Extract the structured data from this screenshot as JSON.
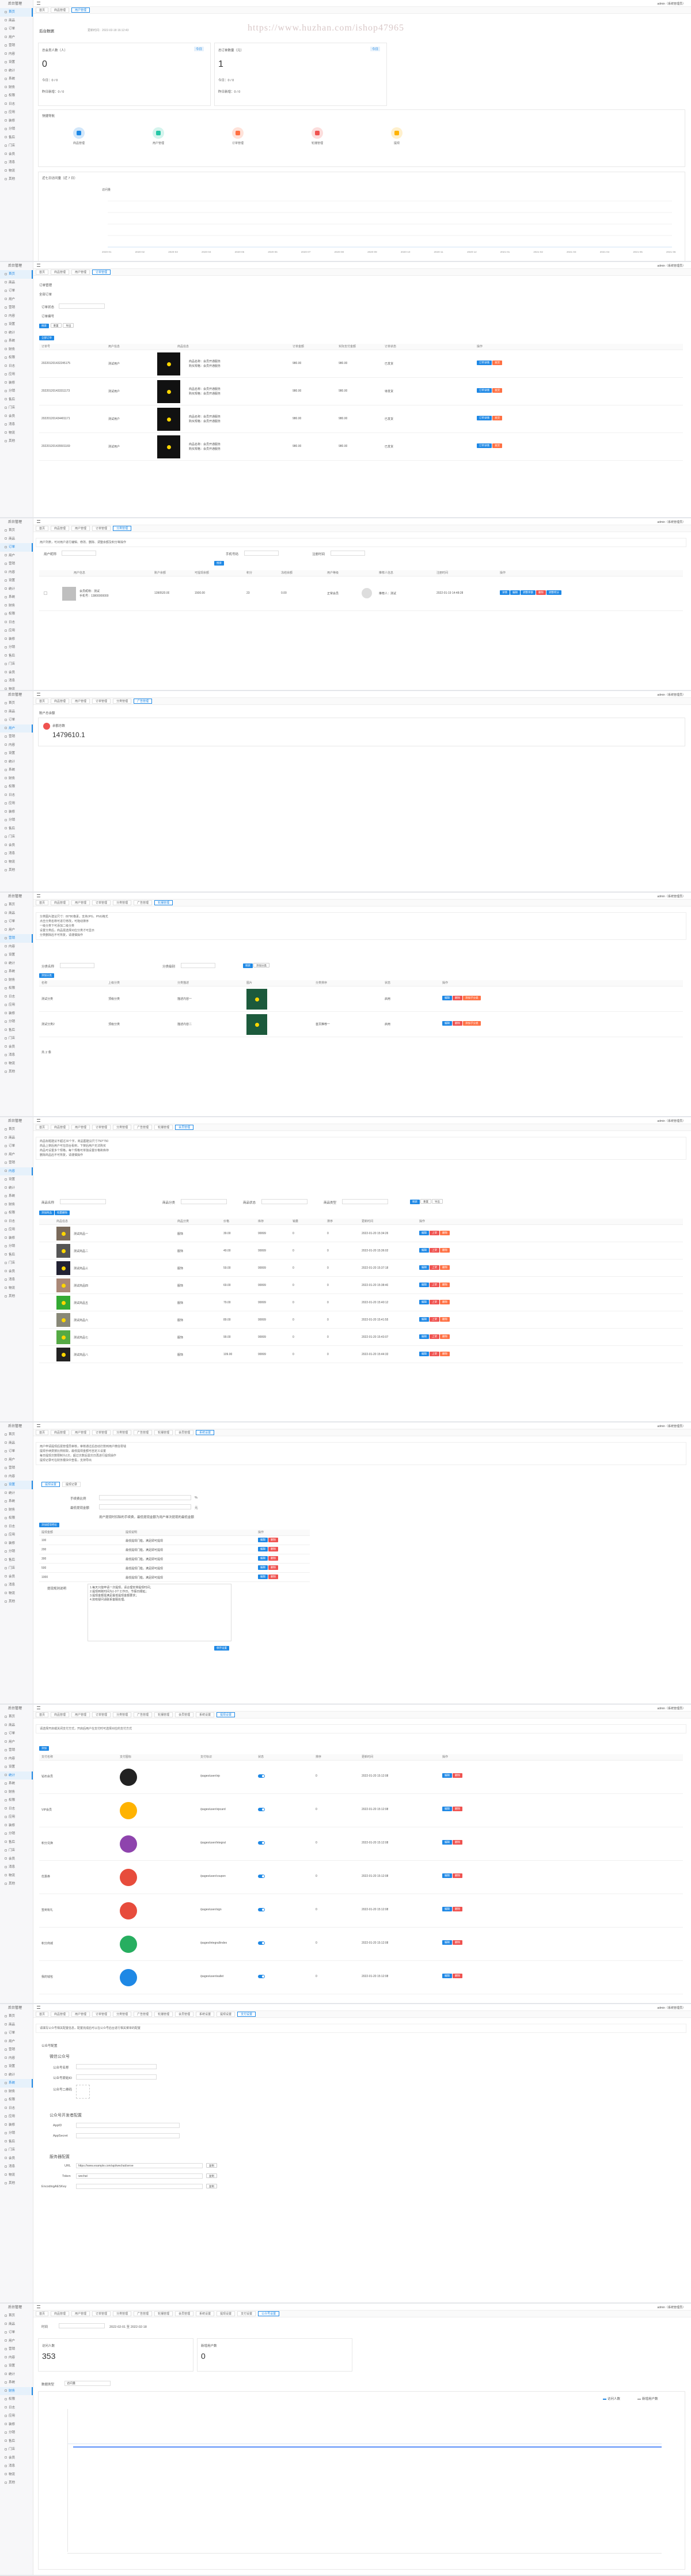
{
  "app": {
    "user": "admin（系统管理员）",
    "logo_text": "后台管理",
    "home_tab": "首页",
    "watermark": "https://www.huzhan.com/ishop47965"
  },
  "colors": {
    "primary": "#1e88e5",
    "danger": "#ef5350",
    "warn": "#ff7043"
  },
  "sidebar": [
    "后台管理",
    "首页",
    "商品",
    "订单",
    "用户",
    "营销",
    "内容",
    "设置",
    "统计",
    "系统",
    "财务",
    "权限",
    "日志",
    "应用",
    "装修",
    "分销",
    "售后",
    "门店",
    "会员",
    "消息",
    "物流",
    "其他"
  ],
  "tabs": [
    "首页",
    "商品管理",
    "用户管理",
    "订单管理",
    "分类管理",
    "广告管理",
    "轮播管理",
    "会员管理",
    "系统设置",
    "提现设置",
    "支付设置",
    "公众号设置",
    "版本",
    "数据"
  ],
  "dash": {
    "title": "后台数据",
    "date": "更新时间：2022-02-18 16:12:43",
    "card1_label": "总会员人数（人）",
    "card1_tag": "今日",
    "card1_value": "0",
    "card1_sub1": "今日：0 / 0",
    "card1_sub2": "昨日新增：0 / 0",
    "card2_label": "总订单数量（元）",
    "card2_tag": "今日",
    "card2_value": "1",
    "card2_sub1": "今日：0 / 0",
    "card2_sub2": "昨日新增：0 / 0",
    "quick_title": "快捷导航",
    "quick": [
      "商品管理",
      "用户管理",
      "订单管理",
      "轮播管理",
      "提现"
    ],
    "chart_title": "近七日访问量（近 7 日）",
    "chart_series": "访问量",
    "chart_months": [
      "2020-01",
      "2020-02",
      "2020-03",
      "2020-04",
      "2020-05",
      "2020-06",
      "2020-07",
      "2020-08",
      "2020-09",
      "2020-10",
      "2020-11",
      "2020-12",
      "2021-01",
      "2021-02",
      "2021-03",
      "2021-04",
      "2021-05",
      "2021-06"
    ]
  },
  "orders": {
    "sub": [
      "订单管理",
      "全部订单"
    ],
    "filter_label": "订单状态",
    "filter2": "订单编号",
    "btn_search": "搜索",
    "btn_reset": "重置",
    "btn_export": "导出",
    "tag": "全部订单",
    "cols": [
      "订单号",
      "用户信息",
      "商品信息",
      "订单金额",
      "实际支付金额",
      "订单状态",
      "操作"
    ],
    "rows": [
      {
        "no": "202201201432245175",
        "user": "测试用户",
        "info1": "商品名称：会员开通服务",
        "info2": "购买规格：会员开通服务",
        "amount": "980.00",
        "paid": "980.00",
        "status": "已发货"
      },
      {
        "no": "202201201433311173",
        "user": "测试用户",
        "info1": "商品名称：会员开通服务",
        "info2": "购买规格：会员开通服务",
        "amount": "980.00",
        "paid": "980.00",
        "status": "待发货"
      },
      {
        "no": "202201201434401171",
        "user": "测试用户",
        "info1": "商品名称：会员开通服务",
        "info2": "购买规格：会员开通服务",
        "amount": "980.00",
        "paid": "980.00",
        "status": "已发货"
      },
      {
        "no": "202201201435501169",
        "user": "测试用户",
        "info1": "商品名称：会员开通服务",
        "info2": "购买规格：会员开通服务",
        "amount": "980.00",
        "paid": "980.00",
        "status": "已发货"
      }
    ],
    "b1": "订单详情",
    "b2": "发货"
  },
  "users": {
    "tip": "用户列表，可对用户进行编辑、修改、删除、调整余额及积分等操作",
    "lbl1": "用户昵称",
    "lbl2": "手机号码",
    "lbl3": "注册时间",
    "btn": "搜索",
    "cols": [
      "用户信息",
      "账户余额",
      "可提现余额",
      "积分",
      "冻结余额",
      "用户等级",
      "推荐人信息",
      "注册时间",
      "操作"
    ],
    "row": {
      "name": "会员昵称：测试",
      "phone": "手机号：13800000000",
      "bal": "1390520.00",
      "cash": "1500.00",
      "pts": "23",
      "frz": "0.00",
      "lvl": "正常会员",
      "ref": "推荐人：测试",
      "time": "2022-01-19 14:48:28"
    },
    "btns": [
      "详情",
      "编辑",
      "调整余额",
      "删除",
      "调整积分"
    ]
  },
  "balance": {
    "title": "账户总余额",
    "label": "余额总数",
    "value": "1479610.1"
  },
  "cats": {
    "tip": [
      "分类图片建议尺寸：80*80像素，支持JPG、PNG格式",
      "点击分类名称可进行修改，可拖动排序",
      "一级分类下可添加二级分类",
      "设置分类后，商品需选择对应分类才可显示",
      "分类删除后不可恢复，请谨慎操作"
    ],
    "lbl1": "分类名称",
    "lbl2": "分类级别",
    "btn1": "搜索",
    "btn2": "添加分类",
    "tag": "添加分类",
    "cols": [
      "名称",
      "上级分类",
      "分类描述",
      "图片",
      "分类排序",
      "状态",
      "操作"
    ],
    "rows": [
      {
        "name": "测试分类",
        "parent": "顶级分类",
        "desc": "描述内容一",
        "sort": "",
        "status": "启用"
      },
      {
        "name": "测试分类2",
        "parent": "顶级分类",
        "desc": "描述内容二",
        "sort": "首页推荐一",
        "status": "启用"
      }
    ],
    "btns": [
      "编辑",
      "删除",
      "添加子分类"
    ],
    "pager": "共 2 条"
  },
  "goods": {
    "tip": [
      "商品标题建议不超过30个字，商品图建议尺寸750*750",
      "商品上架后用户可在前台看到，下架后用户无法购买",
      "商品可设置多个规格，每个规格可单独设置价格和库存",
      "删除商品后不可恢复，请谨慎操作"
    ],
    "lbl1": "商品名称",
    "lbl2": "商品分类",
    "lbl3": "商品状态",
    "lbl4": "商品类型",
    "btn1": "搜索",
    "btn2": "重置",
    "btn3": "导出",
    "tag1": "添加商品",
    "tag2": "批量删除",
    "cols": [
      "商品信息",
      "商品分类",
      "价格",
      "库存",
      "销量",
      "排序",
      "更新时间",
      "操作"
    ],
    "rows": [
      {
        "name": "测试商品一",
        "cat": "服饰",
        "price": "39.00",
        "stock": "99999",
        "sales": "0",
        "sort": "0",
        "time": "2022-01-20 15:34:26"
      },
      {
        "name": "测试商品二",
        "cat": "服饰",
        "price": "49.00",
        "stock": "99999",
        "sales": "0",
        "sort": "0",
        "time": "2022-01-20 15:36:02"
      },
      {
        "name": "测试商品三",
        "cat": "服饰",
        "price": "59.00",
        "stock": "99999",
        "sales": "0",
        "sort": "0",
        "time": "2022-01-20 15:37:18"
      },
      {
        "name": "测试商品四",
        "cat": "服饰",
        "price": "69.00",
        "stock": "99999",
        "sales": "0",
        "sort": "0",
        "time": "2022-01-20 15:38:40"
      },
      {
        "name": "测试商品五",
        "cat": "服饰",
        "price": "79.00",
        "stock": "99999",
        "sales": "0",
        "sort": "0",
        "time": "2022-01-20 15:40:12"
      },
      {
        "name": "测试商品六",
        "cat": "服饰",
        "price": "89.00",
        "stock": "99999",
        "sales": "0",
        "sort": "0",
        "time": "2022-01-20 15:41:55"
      },
      {
        "name": "测试商品七",
        "cat": "服饰",
        "price": "99.00",
        "stock": "99999",
        "sales": "0",
        "sort": "0",
        "time": "2022-01-20 15:43:07"
      },
      {
        "name": "测试商品八",
        "cat": "服饰",
        "price": "109.00",
        "stock": "99999",
        "sales": "0",
        "sort": "0",
        "time": "2022-01-20 15:44:33"
      }
    ],
    "btns": [
      "编辑",
      "上架",
      "删除"
    ]
  },
  "withdraw": {
    "tip": [
      "用户申请提现后需管理员审核，审核通过后自动打款到用户微信零钱",
      "提现手续费按比例收取，最低提现金额可自定义设置",
      "每日提现次数限制为1次，超过次数后需次日再进行提现操作",
      "提现记录可在财务模块中查看，支持导出"
    ],
    "tab1": "提现设置",
    "tab2": "提现记录",
    "lbl1": "手续费比例",
    "lbl2": "最低提现金额",
    "unit1": "%",
    "unit2": "元",
    "note": "用户提现时扣除的手续费，最低提现金额为用户单次提现的最低金额",
    "tag": "添加提现档位",
    "cols": [
      "提现金额",
      "提现说明",
      "操作"
    ],
    "rows": [
      {
        "a": "100",
        "d": "最低提现门槛，满足即可提现"
      },
      {
        "a": "200",
        "d": "最低提现门槛，满足即可提现"
      },
      {
        "a": "300",
        "d": "最低提现门槛，满足即可提现"
      },
      {
        "a": "500",
        "d": "最低提现门槛，满足即可提现"
      },
      {
        "a": "1000",
        "d": "最低提现门槛，满足即可提现"
      }
    ],
    "desc_label": "提现规则说明",
    "desc": [
      "1.每天只能申请一次提现，请合理安排提现时间；",
      "2.提现到账时间为1-3个工作日，节假日顺延；",
      "3.提现金额需满足最低提现金额要求；",
      "4.如有疑问请联系客服处理。"
    ],
    "save": "保存设置"
  },
  "pay": {
    "tip": "请选择开启或关闭支付方式，开启后用户在支付时可选择对应的支付方式",
    "tag": "添加",
    "cols": [
      "支付名称",
      "支付图标",
      "支付标识",
      "状态",
      "排序",
      "更新时间",
      "操作"
    ],
    "rows": [
      {
        "name": "钻石会员",
        "code": "/pages/user/vip"
      },
      {
        "name": "VIP会员",
        "code": "/pages/user/vipcard"
      },
      {
        "name": "积分兑换",
        "code": "/pages/user/integral"
      },
      {
        "name": "优惠券",
        "code": "/pages/user/coupon"
      },
      {
        "name": "签到有礼",
        "code": "/pages/user/sign"
      },
      {
        "name": "积分商城",
        "code": "/pages/integral/index"
      },
      {
        "name": "我的钱包",
        "code": "/pages/user/wallet"
      }
    ],
    "sort": "0",
    "time": "2022-01-20 15:12:08",
    "btns": [
      "编辑",
      "删除"
    ]
  },
  "wechat": {
    "tip": "请填写公众号相关配置信息，配置完成后可以在公众号后台进行相关菜单的配置",
    "s1": "公众号配置",
    "s1_title": "微信公众号",
    "lbl": [
      "公众号名称",
      "公众号原始ID",
      "公众号二维码"
    ],
    "s2": "公众号开发者配置",
    "lbl2": [
      "AppID",
      "AppSecret"
    ],
    "s3": "服务器配置",
    "lbl3": [
      "URL",
      "Token",
      "EncodingAESKey"
    ],
    "url": "https://www.example.com/api/wechat/serve",
    "token": "wechat",
    "copy": "复制"
  },
  "stats": {
    "lbl_time": "时间",
    "range": "2022-02-01 至 2022-02-18",
    "card1_label": "访问人数",
    "card1_value": "353",
    "card2_label": "新增用户数",
    "card2_value": "0",
    "lbl_type": "数据类型",
    "type": "访问量",
    "legend1": "访问人数",
    "legend2": "新增用户数"
  }
}
